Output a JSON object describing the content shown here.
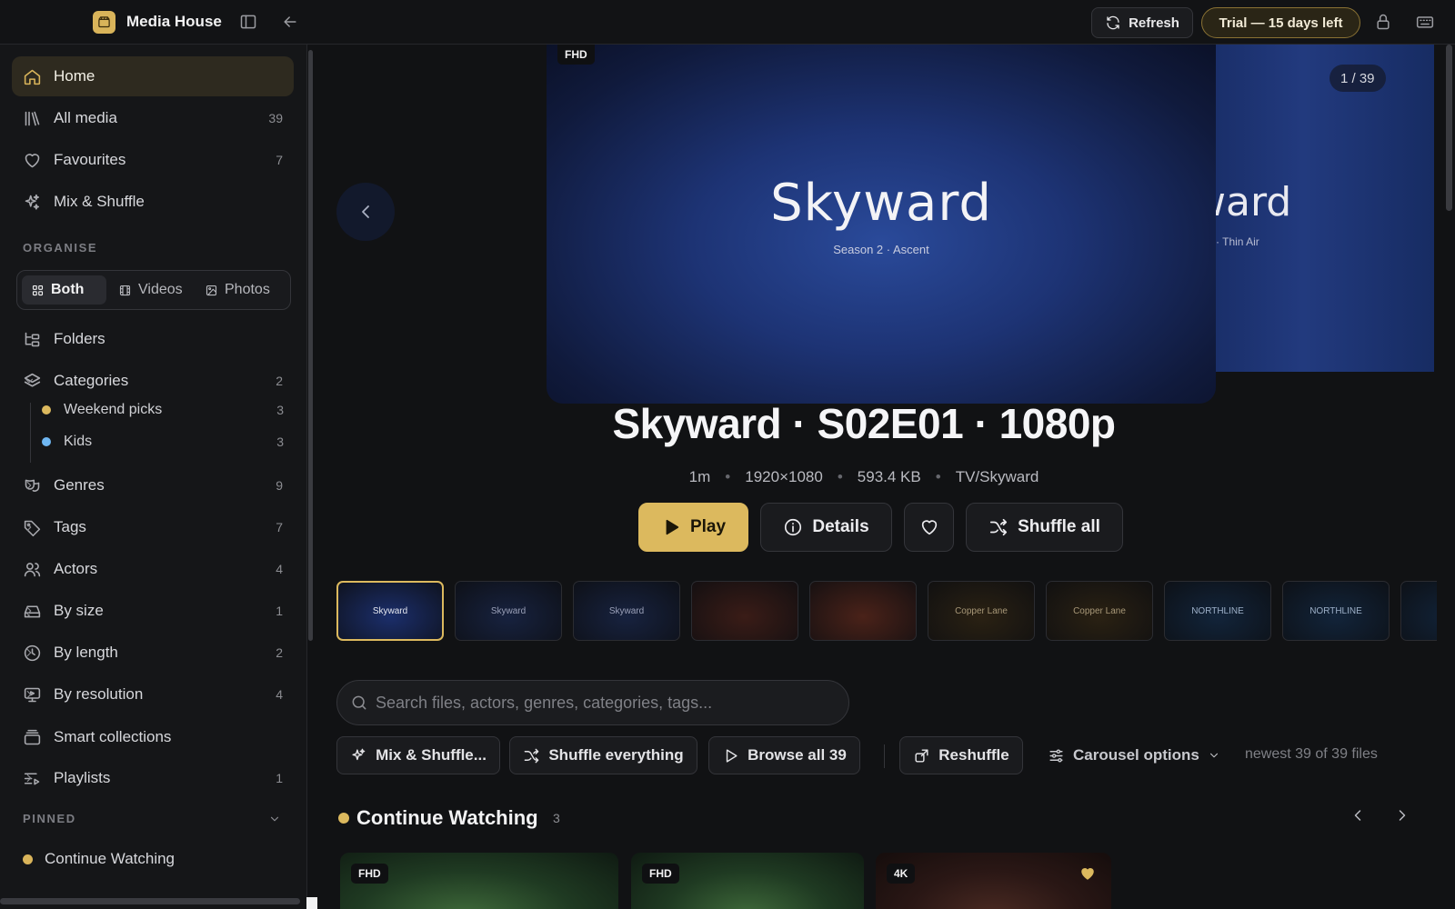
{
  "app": {
    "title": "Media House",
    "refresh_label": "Refresh",
    "trial_label": "Trial — 15 days left"
  },
  "sidebar": {
    "main_items": [
      {
        "label": "Home",
        "count": "",
        "icon": "home-icon",
        "active": true
      },
      {
        "label": "All media",
        "count": "39",
        "icon": "library-icon"
      },
      {
        "label": "Favourites",
        "count": "7",
        "icon": "heart-icon"
      },
      {
        "label": "Mix & Shuffle",
        "count": "",
        "icon": "sparkles-icon"
      }
    ],
    "organise_label": "ORGANISE",
    "filter": {
      "options": [
        "Both",
        "Videos",
        "Photos"
      ],
      "selected": "Both"
    },
    "folders_label": "Folders",
    "categories": {
      "label": "Categories",
      "count": "2",
      "children": [
        {
          "label": "Weekend picks",
          "count": "3",
          "color": "#dcb95e"
        },
        {
          "label": "Kids",
          "count": "3",
          "color": "#6fb7f2"
        }
      ]
    },
    "group_items": [
      {
        "label": "Genres",
        "count": "9"
      },
      {
        "label": "Tags",
        "count": "7"
      },
      {
        "label": "Actors",
        "count": "4"
      },
      {
        "label": "By size",
        "count": "1"
      },
      {
        "label": "By length",
        "count": "2"
      },
      {
        "label": "By resolution",
        "count": "4"
      },
      {
        "label": "Smart collections",
        "count": ""
      },
      {
        "label": "Playlists",
        "count": "1"
      }
    ],
    "pinned_label": "PINNED",
    "pinned_items": [
      {
        "label": "Continue Watching",
        "color": "#dcb95e"
      }
    ]
  },
  "hero": {
    "badge": "FHD",
    "slide_title": "Skyward",
    "slide_subtitle": "Season 2 · Ascent",
    "next_slide_title": "ward",
    "next_slide_subtitle": "· Thin Air",
    "counter": "1 / 39",
    "title": "Skyward · S02E01 · 1080p",
    "meta": [
      "1m",
      "1920×1080",
      "593.4 KB",
      "TV/Skyward"
    ],
    "play_label": "Play",
    "details_label": "Details",
    "shuffle_label": "Shuffle all"
  },
  "thumbnails": [
    {
      "text": "Skyward",
      "selected": true,
      "bg": "#1b2e6b",
      "fg": "#e6e8f0"
    },
    {
      "text": "Skyward",
      "bg": "#17223f",
      "fg": "#9aa0b8"
    },
    {
      "text": "Skyward",
      "bg": "#17223f",
      "fg": "#9aa0b8"
    },
    {
      "text": "",
      "bg": "#3a1c17",
      "fg": "#cfa27a"
    },
    {
      "text": "",
      "bg": "#4a2219",
      "fg": "#cfa27a"
    },
    {
      "text": "Copper Lane",
      "bg": "#2a2113",
      "fg": "#a89878"
    },
    {
      "text": "Copper Lane",
      "bg": "#2a2113",
      "fg": "#a89878"
    },
    {
      "text": "NORTHLINE",
      "bg": "#12243a",
      "fg": "#9db0c8"
    },
    {
      "text": "NORTHLINE",
      "bg": "#12243a",
      "fg": "#9db0c8"
    },
    {
      "text": "",
      "bg": "#12243a",
      "fg": "#9db0c8"
    }
  ],
  "search": {
    "placeholder": "Search files, actors, genres, categories, tags..."
  },
  "toolbar": {
    "mix_label": "Mix & Shuffle...",
    "shuffle_everything_label": "Shuffle everything",
    "browse_label": "Browse all 39",
    "reshuffle_label": "Reshuffle",
    "carousel_label": "Carousel options",
    "file_count": "newest 39 of 39 files"
  },
  "continue_watching": {
    "title": "Continue Watching",
    "count": "3",
    "cards": [
      {
        "badge": "FHD",
        "favourite": false
      },
      {
        "badge": "FHD",
        "favourite": false
      },
      {
        "badge": "4K",
        "favourite": true
      }
    ]
  },
  "colors": {
    "accent": "#dcb95e",
    "background": "#111214",
    "sidebar": "#151618"
  }
}
